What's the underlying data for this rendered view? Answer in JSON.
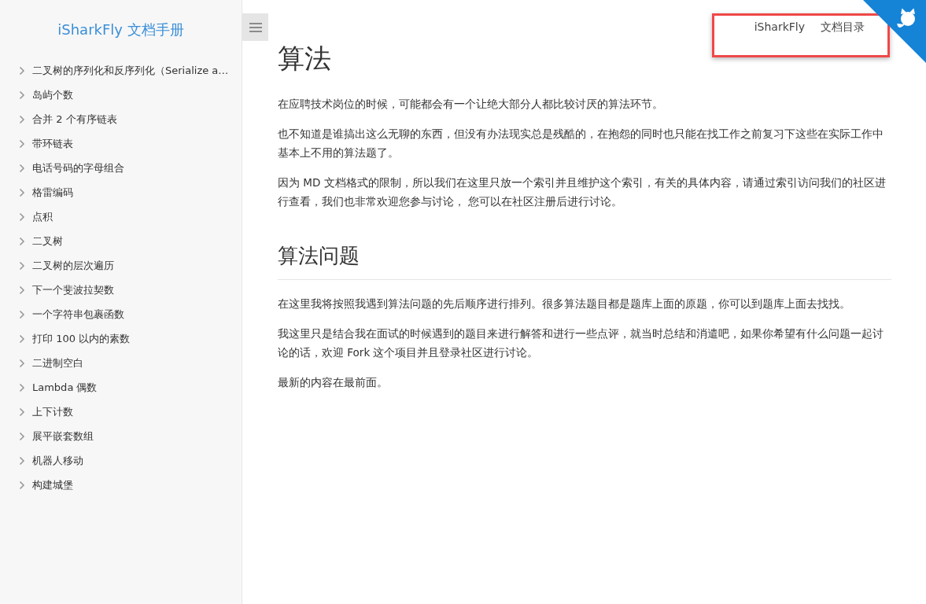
{
  "sidebar": {
    "title": "iSharkFly 文档手册",
    "items": [
      {
        "label": "二叉树的序列化和反序列化（Serialize a…",
        "expanded": false
      },
      {
        "label": "岛屿个数",
        "expanded": false
      },
      {
        "label": "合并 2 个有序链表",
        "expanded": false
      },
      {
        "label": "带环链表",
        "expanded": false
      },
      {
        "label": "电话号码的字母组合",
        "expanded": false
      },
      {
        "label": "格雷编码",
        "expanded": false
      },
      {
        "label": "点积",
        "expanded": false
      },
      {
        "label": "二叉树",
        "expanded": false
      },
      {
        "label": "二叉树的层次遍历",
        "expanded": false
      },
      {
        "label": "下一个斐波拉契数",
        "expanded": false
      },
      {
        "label": "一个字符串包裹函数",
        "expanded": false
      },
      {
        "label": "打印 100 以内的素数",
        "expanded": false
      },
      {
        "label": "二进制空白",
        "expanded": false
      },
      {
        "label": "Lambda 偶数",
        "expanded": false
      },
      {
        "label": "上下计数",
        "expanded": false
      },
      {
        "label": "展平嵌套数组",
        "expanded": false
      },
      {
        "label": "机器人移动",
        "expanded": false
      },
      {
        "label": "构建城堡",
        "expanded": false
      }
    ]
  },
  "nav": {
    "links": [
      "iSharkFly",
      "文档目录"
    ]
  },
  "article": {
    "title": "算法",
    "intro": [
      "在应聘技术岗位的时候，可能都会有一个让绝大部分人都比较讨厌的算法环节。",
      "也不知道是谁搞出这么无聊的东西，但没有办法现实总是残酷的，在抱怨的同时也只能在找工作之前复习下这些在实际工作中基本上不用的算法题了。",
      "因为 MD 文档格式的限制，所以我们在这里只放一个索引并且维护这个索引，有关的具体内容，请通过索引访问我们的社区进行查看，我们也非常欢迎您参与讨论， 您可以在社区注册后进行讨论。"
    ],
    "section_title": "算法问题",
    "section": [
      "在这里我将按照我遇到算法问题的先后顺序进行排列。很多算法题目都是题库上面的原题，你可以到题库上面去找找。",
      "我这里只是结合我在面试的时候遇到的题目来进行解答和进行一些点评，就当时总结和消遣吧，如果你希望有什么问题一起讨论的话，欢迎 Fork 这个项目并且登录社区进行讨论。",
      "最新的内容在最前面。"
    ]
  }
}
